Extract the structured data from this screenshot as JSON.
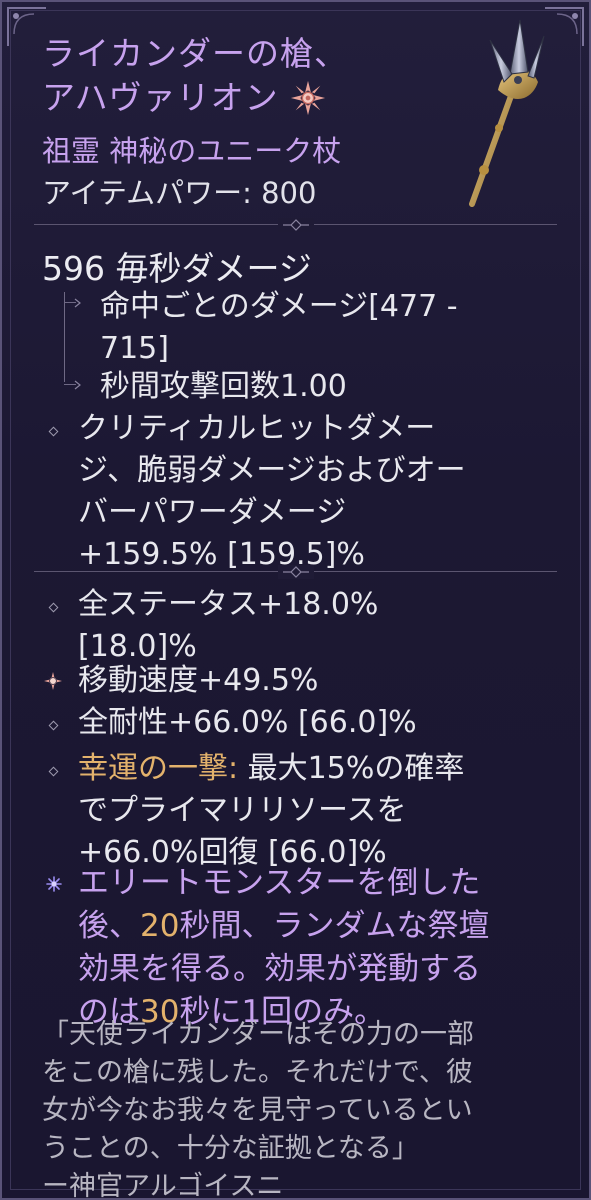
{
  "item": {
    "name_line1": "ライカンダーの槍、",
    "name_line2": "アハヴァリオン",
    "mythic_icon": "mythic-sun-icon",
    "type": "祖霊 神秘のユニーク杖",
    "item_power": "アイテムパワー: 800",
    "weapon_icon": "spear-staff-icon"
  },
  "damage": {
    "dps": "596 毎秒ダメージ",
    "per_hit_line1": "命中ごとのダメージ[477 -",
    "per_hit_line2": "715]",
    "attacks_per_second": "秒間攻撃回数1.00"
  },
  "implicit": {
    "line1": "クリティカルヒットダメー",
    "line2": "ジ、脆弱ダメージおよびオー",
    "line3": "バーパワーダメージ",
    "line4": "+159.5% [159.5]%"
  },
  "affixes": [
    {
      "line1": "全ステータス+18.0%",
      "line2": "[18.0]%",
      "icon": "diamond-bullet-icon"
    },
    {
      "line1": "移動速度+49.5%",
      "icon": "greater-affix-star-icon"
    },
    {
      "line1": "全耐性+66.0% [66.0]%",
      "icon": "diamond-bullet-icon"
    },
    {
      "label": "幸運の一撃:",
      "line1_rest": " 最大15%の確率",
      "line2": "でプライマリリソースを",
      "line3": "+66.0%回復 [66.0]%",
      "icon": "diamond-bullet-icon"
    }
  ],
  "unique_power": {
    "icon": "unique-power-star-icon",
    "line1": "エリートモンスターを倒した",
    "line2_a": "後、",
    "line2_num": "20",
    "line2_b": "秒間、ランダムな祭壇",
    "line3": "効果を得る。効果が発動する",
    "line4_a": "のは",
    "line4_num": "30",
    "line4_b": "秒に1回のみ。"
  },
  "flavor": {
    "line1": "「天使ライカンダーはその力の一部",
    "line2": "をこの槍に残した。それだけで、彼",
    "line3": "女が今なお我々を見守っているとい",
    "line4": "うことの、十分な証拠となる」",
    "line5": "ー神官アルゴイスニ"
  },
  "colors": {
    "unique_purple": "#c7a2ee",
    "gold": "#e3b26c",
    "text": "#e8e8ee",
    "background": "#1c1833"
  }
}
